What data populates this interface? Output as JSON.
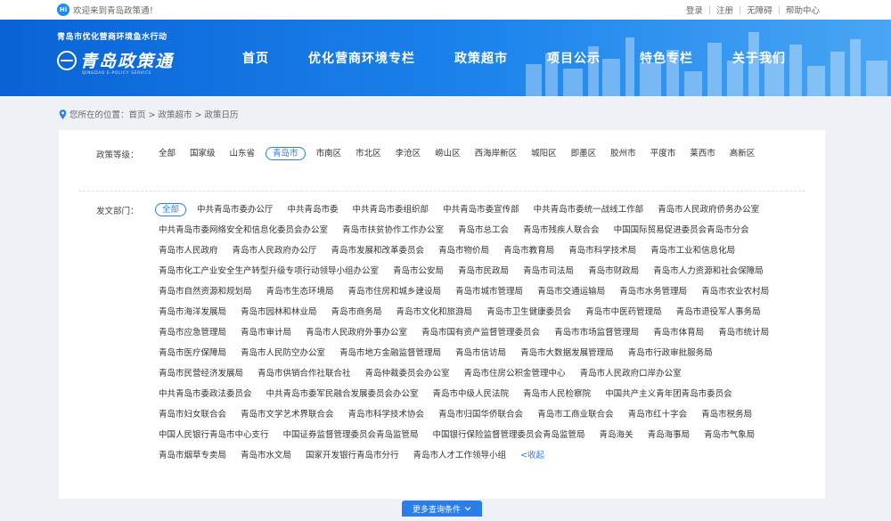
{
  "topbar": {
    "welcome": "欢迎来到青岛政策通！",
    "badge": "Hi",
    "links": [
      "登录",
      "注册",
      "无障碍",
      "帮助中心"
    ]
  },
  "header": {
    "slogan": "青岛市优化营商环境鱼水行动",
    "logo_text": "青岛政策通",
    "logo_sub": "QINGDAO E-POLICY SERVICE",
    "nav": [
      "首页",
      "优化营商环境专栏",
      "政策超市",
      "项目公示",
      "特色专栏",
      "关于我们"
    ]
  },
  "breadcrumb": "您所在的位置：首页 > 政策超市 > 政策日历",
  "filters": {
    "level_label": "政策等级：",
    "levels": [
      "全部",
      "国家级",
      "山东省",
      "青岛市",
      "市南区",
      "市北区",
      "李沧区",
      "崂山区",
      "西海岸新区",
      "城阳区",
      "即墨区",
      "胶州市",
      "平度市",
      "莱西市",
      "高新区"
    ],
    "level_active": "青岛市",
    "dept_label": "发文部门：",
    "departments": [
      "全部",
      "中共青岛市委办公厅",
      "中共青岛市委",
      "中共青岛市委组织部",
      "中共青岛市委宣传部",
      "中共青岛市委统一战线工作部",
      "青岛市人民政府侨务办公室",
      "中共青岛市委网络安全和信息化委员会办公室",
      "青岛市扶贫协作工作办公室",
      "青岛市总工会",
      "青岛市残疾人联合会",
      "中国国际贸易促进委员会青岛市分会",
      "青岛市人民政府",
      "青岛市人民政府办公厅",
      "青岛市发展和改革委员会",
      "青岛市物价局",
      "青岛市教育局",
      "青岛市科学技术局",
      "青岛市工业和信息化局",
      "青岛市化工产业安全生产转型升级专项行动领导小组办公室",
      "青岛市公安局",
      "青岛市民政局",
      "青岛市司法局",
      "青岛市财政局",
      "青岛市人力资源和社会保障局",
      "青岛市自然资源和规划局",
      "青岛市生态环境局",
      "青岛市住房和城乡建设局",
      "青岛市城市管理局",
      "青岛市交通运输局",
      "青岛市水务管理局",
      "青岛市农业农村局",
      "青岛市海洋发展局",
      "青岛市园林和林业局",
      "青岛市商务局",
      "青岛市文化和旅游局",
      "青岛市卫生健康委员会",
      "青岛市中医药管理局",
      "青岛市退役军人事务局",
      "青岛市应急管理局",
      "青岛市审计局",
      "青岛市人民政府外事办公室",
      "青岛市国有资产监督管理委员会",
      "青岛市市场监督管理局",
      "青岛市体育局",
      "青岛市统计局",
      "青岛市医疗保障局",
      "青岛市人民防空办公室",
      "青岛市地方金融监督管理局",
      "青岛市信访局",
      "青岛市大数据发展管理局",
      "青岛市行政审批服务局",
      "青岛市民营经济发展局",
      "青岛市供销合作社联合社",
      "青岛仲裁委员会办公室",
      "青岛市住房公积金管理中心",
      "青岛市人民政府口岸办公室",
      "中共青岛市委政法委员会",
      "中共青岛市委军民融合发展委员会办公室",
      "青岛市中级人民法院",
      "青岛市人民检察院",
      "中国共产主义青年团青岛市委员会",
      "青岛市妇女联合会",
      "青岛市文学艺术界联合会",
      "青岛市科学技术协会",
      "青岛市归国华侨联合会",
      "青岛市工商业联合会",
      "青岛市红十字会",
      "青岛市税务局",
      "中国人民银行青岛市中心支行",
      "中国证券监督管理委员会青岛监管局",
      "中国银行保险监督管理委员会青岛监管局",
      "青岛海关",
      "青岛海事局",
      "青岛市气象局",
      "青岛市烟草专卖局",
      "青岛市水文局",
      "国家开发银行青岛市分行",
      "青岛市人才工作领导小组"
    ],
    "dept_active": "全部",
    "collapse": "<收起"
  },
  "more_button": "更多查询条件"
}
